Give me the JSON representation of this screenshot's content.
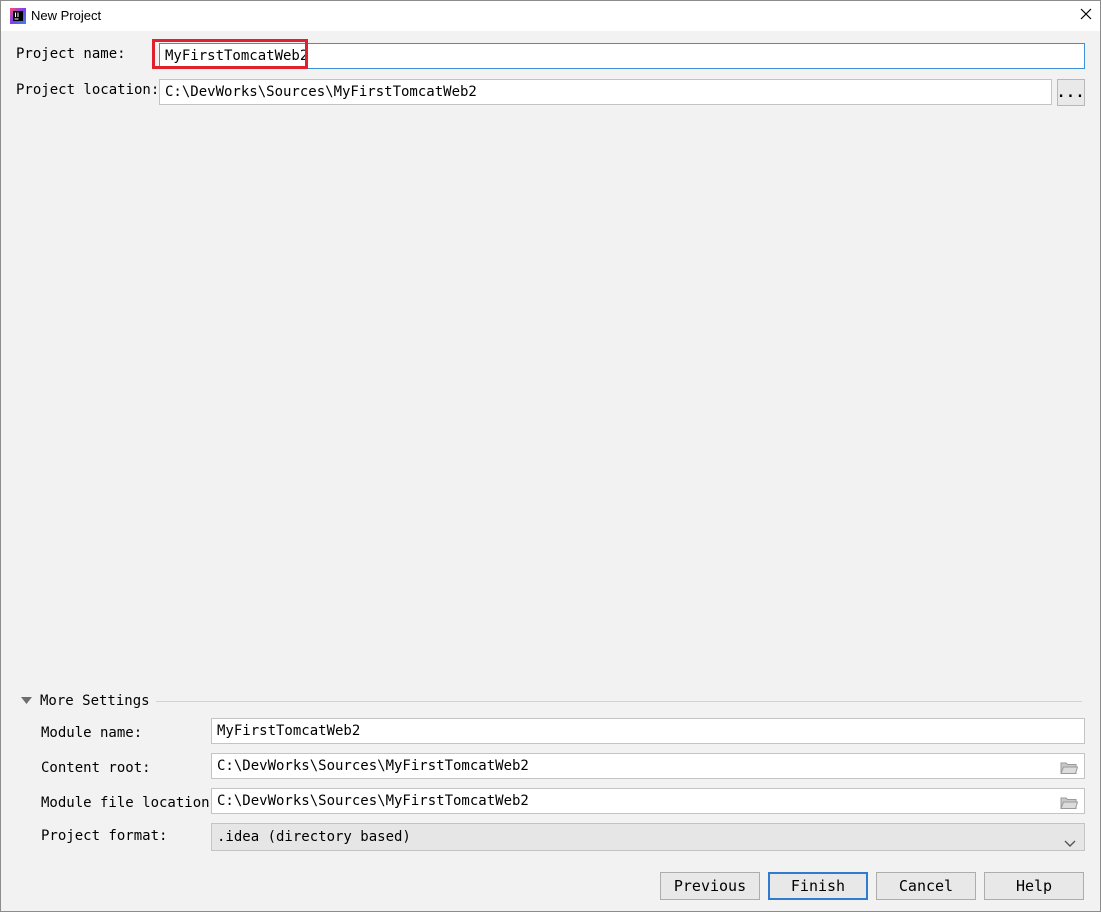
{
  "window": {
    "title": "New Project",
    "app_icon": "intellij-idea-icon",
    "close_icon": "close-icon"
  },
  "form": {
    "project_name_label": "Project name:",
    "project_name_value": "MyFirstTomcatWeb2",
    "project_location_label": "Project location:",
    "project_location_value": "C:\\DevWorks\\Sources\\MyFirstTomcatWeb2",
    "browse_label": "..."
  },
  "more_settings": {
    "title": "More Settings",
    "expanded": true,
    "module_name_label": "Module name:",
    "module_name_value": "MyFirstTomcatWeb2",
    "content_root_label": "Content root:",
    "content_root_value": "C:\\DevWorks\\Sources\\MyFirstTomcatWeb2",
    "module_file_location_label": "Module file location:",
    "module_file_location_value": "C:\\DevWorks\\Sources\\MyFirstTomcatWeb2",
    "project_format_label": "Project format:",
    "project_format_value": ".idea (directory based)"
  },
  "buttons": {
    "previous": "Previous",
    "finish": "Finish",
    "cancel": "Cancel",
    "help": "Help"
  },
  "colors": {
    "highlight_outline": "#e0202a",
    "focus_border": "#3d8fd6",
    "primary_button_border": "#2e7bd0"
  }
}
